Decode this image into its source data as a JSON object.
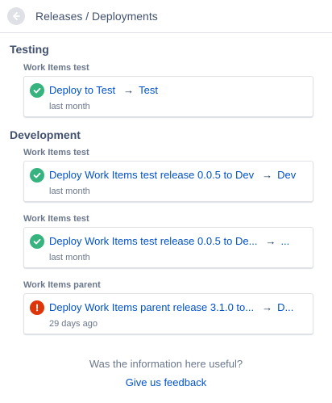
{
  "header": {
    "title": "Releases / Deployments"
  },
  "sections": [
    {
      "title": "Testing",
      "groups": [
        {
          "label": "Work Items test",
          "name": "Deploy to Test",
          "arrow": "→",
          "env": "Test",
          "time": "last month",
          "status": "success"
        }
      ]
    },
    {
      "title": "Development",
      "groups": [
        {
          "label": "Work Items test",
          "name": "Deploy Work Items test release 0.0.5 to Dev",
          "arrow": "→",
          "env": "Dev",
          "time": "last month",
          "status": "success"
        },
        {
          "label": "Work Items test",
          "name": "Deploy Work Items test release 0.0.5 to De...",
          "arrow": "→",
          "env": "...",
          "time": "last month",
          "status": "success"
        },
        {
          "label": "Work Items parent",
          "name": "Deploy Work Items parent release 3.1.0 to...",
          "arrow": "→",
          "env": "D...",
          "time": "29 days ago",
          "status": "error"
        }
      ]
    }
  ],
  "feedback": {
    "question": "Was the information here useful?",
    "link": "Give us feedback"
  },
  "icons": {
    "back": "arrow-left-icon",
    "success": "check-circle-icon",
    "error": "error-circle-icon"
  },
  "colors": {
    "success": "#36b37e",
    "error": "#de350b",
    "link": "#0052cc"
  }
}
